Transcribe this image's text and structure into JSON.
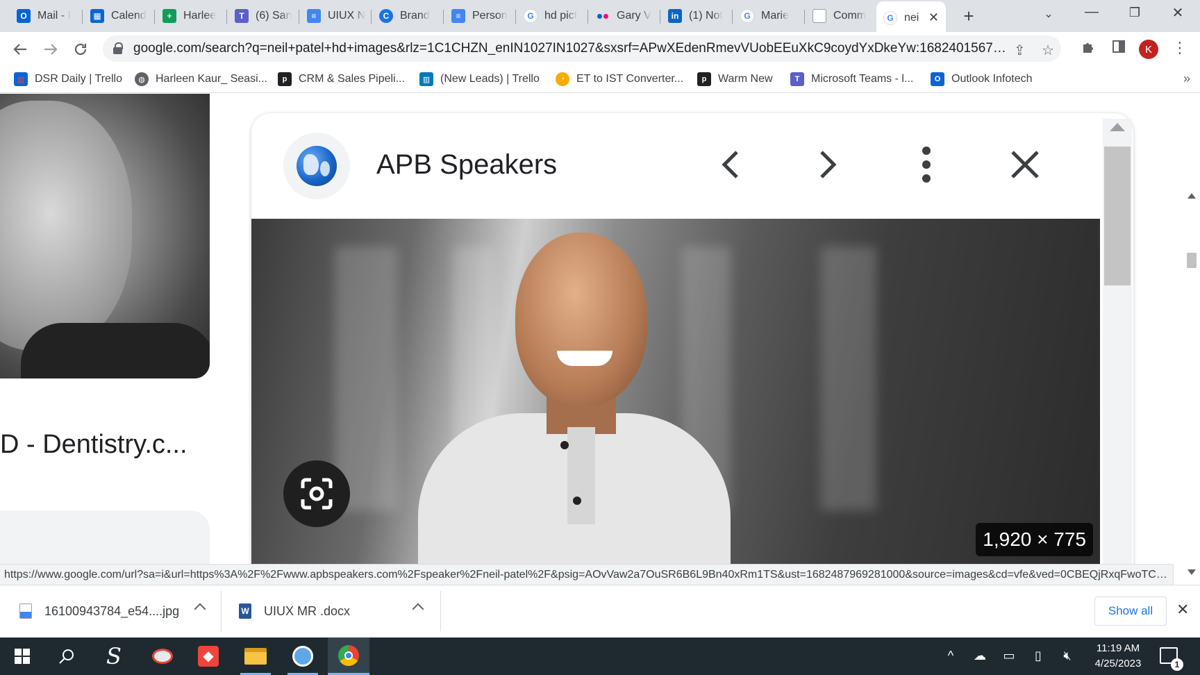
{
  "tabs": [
    {
      "label": "Mail - I",
      "icon": "outlook-icon",
      "color": "#0a64d6"
    },
    {
      "label": "Calend",
      "icon": "calendar-icon",
      "color": "#0a64d6"
    },
    {
      "label": "Harlee",
      "icon": "sheets-icon",
      "color": "#0f9d58"
    },
    {
      "label": "(6) San",
      "icon": "teams-icon",
      "color": "#5b5fc7"
    },
    {
      "label": "UIUX N",
      "icon": "docs-icon",
      "color": "#4285f4"
    },
    {
      "label": "Brand",
      "icon": "canva-icon",
      "color": "#1a73e8"
    },
    {
      "label": "Person",
      "icon": "docs-icon",
      "color": "#4285f4"
    },
    {
      "label": "hd pict",
      "icon": "google-icon",
      "color": "#4285f4"
    },
    {
      "label": "Gary V",
      "icon": "flickr-icon",
      "color": "#ff0084"
    },
    {
      "label": "(1) Not",
      "icon": "linkedin-icon",
      "color": "#0a66c2"
    },
    {
      "label": "Marie",
      "icon": "google-icon",
      "color": "#4285f4"
    },
    {
      "label": "Comm",
      "icon": "page-icon",
      "color": "#9aa0a6"
    },
    {
      "label": "nei",
      "icon": "google-icon",
      "color": "#4285f4",
      "active": true
    }
  ],
  "address_bar": {
    "url": "google.com/search?q=neil+patel+hd+images&rlz=1C1CHZN_enIN1027IN1027&sxsrf=APwXEdenRmevVUobEEuXkC9coydYxDkeYw:1682401567616..."
  },
  "profile_initial": "K",
  "bookmarks": [
    {
      "label": "DSR Daily | Trello",
      "icon": "trello-icon",
      "color": "#e2483d"
    },
    {
      "label": "Harleen Kaur_ Seasi...",
      "icon": "globe-icon",
      "color": "#5f6368"
    },
    {
      "label": "CRM & Sales Pipeli...",
      "icon": "pipedrive-icon",
      "color": "#202124"
    },
    {
      "label": "(New Leads) | Trello",
      "icon": "trello-icon",
      "color": "#0079bf"
    },
    {
      "label": "ET to IST Converter...",
      "icon": "clock-icon",
      "color": "#f9ab00"
    },
    {
      "label": "Warm New",
      "icon": "pipedrive-icon",
      "color": "#202124"
    },
    {
      "label": "Microsoft Teams - l...",
      "icon": "teams-icon",
      "color": "#5b5fc7"
    },
    {
      "label": "Outlook Infotech",
      "icon": "outlook-icon",
      "color": "#0a64d6"
    }
  ],
  "left_result": {
    "caption": "D - Dentistry.c..."
  },
  "preview_panel": {
    "source_name": "APB Speakers",
    "image_dimensions": "1,920 × 775"
  },
  "status_url": "https://www.google.com/url?sa=i&url=https%3A%2F%2Fwww.apbspeakers.com%2Fspeaker%2Fneil-patel%2F&psig=AOvVaw2a7OuSR6B6L9Bn40xRm1TS&ust=1682487969281000&source=images&cd=vfe&ved=0CBEQjRxqFwoTCLj...",
  "downloads": [
    {
      "filename": "16100943784_e54....jpg",
      "icon": "image-file-icon"
    },
    {
      "filename": "UIUX MR .docx",
      "icon": "word-file-icon"
    }
  ],
  "show_all_label": "Show all",
  "taskbar": {
    "time": "11:19 AM",
    "date": "4/25/2023",
    "notification_count": "1"
  }
}
